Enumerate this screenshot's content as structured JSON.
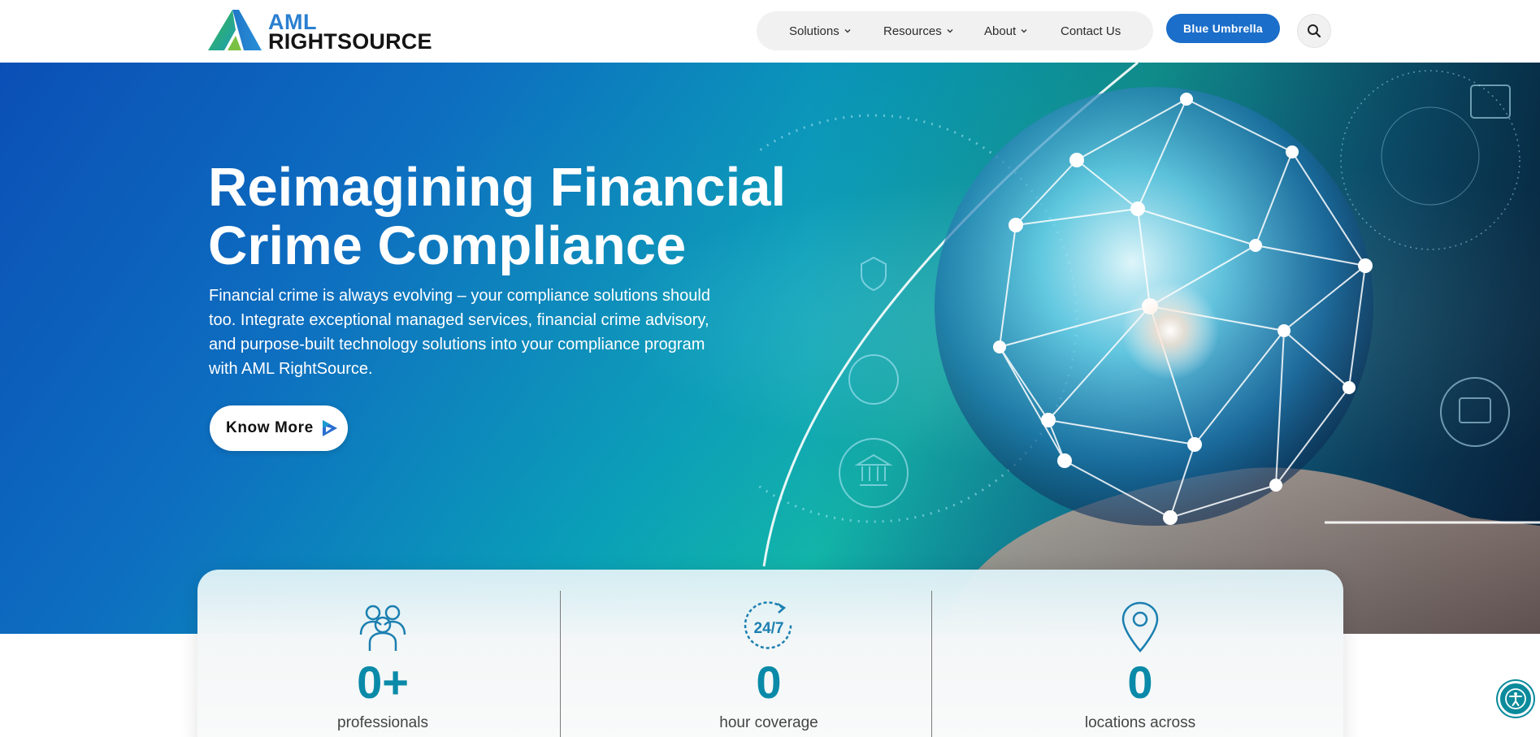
{
  "brand": {
    "line1": "AML",
    "line2": "RIGHTSOURCE",
    "colors": {
      "primary": "#2a7fd0",
      "teal": "#0a8aa8",
      "green": "#3bb54a",
      "dark": "#141414"
    }
  },
  "nav": {
    "items": [
      {
        "label": "Solutions",
        "has_dropdown": true
      },
      {
        "label": "Resources",
        "has_dropdown": true
      },
      {
        "label": "About",
        "has_dropdown": true
      },
      {
        "label": "Contact Us",
        "has_dropdown": false
      }
    ],
    "cta_label": "Blue Umbrella",
    "search_icon": "search-icon"
  },
  "hero": {
    "title_line1": "Reimagining Financial",
    "title_line2": "Crime Compliance",
    "description": "Financial crime is always evolving – your compliance solutions should too. Integrate exceptional managed services, financial crime advisory, and purpose-built technology solutions into your compliance program with AML RightSource.",
    "button_label": "Know More"
  },
  "stats": [
    {
      "icon": "people-group-icon",
      "value": "0+",
      "label": "professionals"
    },
    {
      "icon": "clock-24-7-icon",
      "value": "0",
      "label": "hour coverage"
    },
    {
      "icon": "location-pin-icon",
      "value": "0",
      "label": "locations across"
    }
  ],
  "accessibility_icon": "accessibility-icon"
}
